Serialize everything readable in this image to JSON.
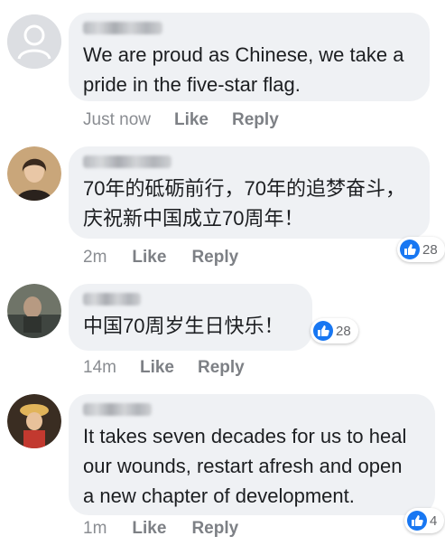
{
  "comments": [
    {
      "text": "We are proud as Chinese, we take a\npride in the five-star flag.",
      "time": "Just now",
      "like_label": "Like",
      "reply_label": "Reply"
    },
    {
      "text": "70年的砥砺前行，70年的追梦奋斗，\n庆祝新中国成立70周年！",
      "time": "2m",
      "like_label": "Like",
      "reply_label": "Reply",
      "reaction_count": "28"
    },
    {
      "text": "中国70周岁生日快乐！",
      "time": "14m",
      "like_label": "Like",
      "reply_label": "Reply",
      "reaction_count": "28"
    },
    {
      "text": "It takes seven decades for us to heal\nour wounds, restart afresh and open\na new chapter of development.",
      "time": "1m",
      "like_label": "Like",
      "reply_label": "Reply",
      "reaction_count": "4"
    }
  ],
  "colors": {
    "bubble": "#eff1f4",
    "like_blue": "#1877f2",
    "meta_gray": "#7d8085",
    "text": "#1c1e21"
  }
}
